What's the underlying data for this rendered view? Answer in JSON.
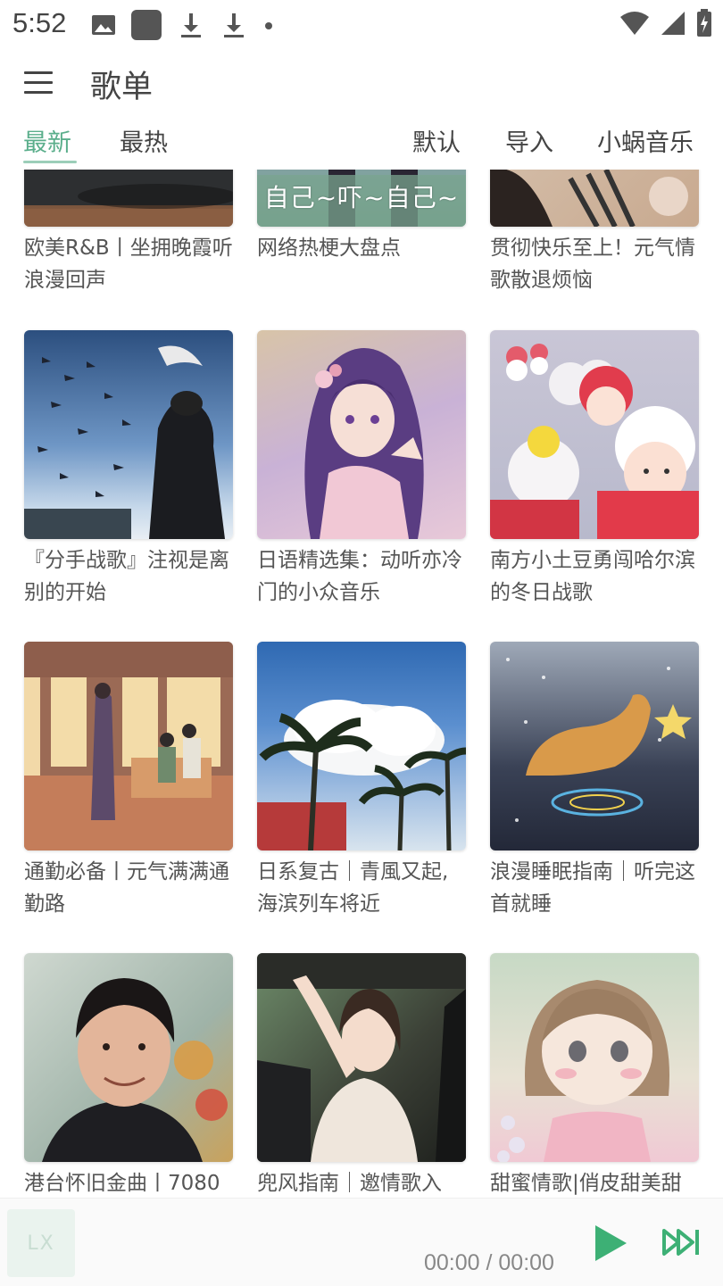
{
  "status_bar": {
    "time": "5:52",
    "icons_left": [
      "image-icon",
      "square-app-icon",
      "download-icon",
      "download-icon",
      "dot-icon"
    ],
    "icons_right": [
      "wifi-icon",
      "signal-icon",
      "battery-charging-icon"
    ]
  },
  "header": {
    "title": "歌单",
    "menu_icon": "hamburger-menu-icon"
  },
  "tabs": {
    "left": [
      {
        "label": "最新",
        "active": true
      },
      {
        "label": "最热",
        "active": false
      }
    ],
    "right": [
      {
        "label": "默认"
      },
      {
        "label": "导入"
      },
      {
        "label": "小蜗音乐"
      }
    ],
    "accent_color": "#5aae8b"
  },
  "playlists": [
    {
      "title": "欧美R&B丨坐拥晚霞听浪漫回声"
    },
    {
      "title": "网络热梗大盘点",
      "cover_text": "自己~吓~自己~"
    },
    {
      "title": "贯彻快乐至上！元气情歌散退烦恼"
    },
    {
      "title": "『分手战歌』注视是离别的开始"
    },
    {
      "title": "日语精选集：动听亦冷门的小众音乐"
    },
    {
      "title": "南方小土豆勇闯哈尔滨的冬日战歌"
    },
    {
      "title": "通勤必备丨元气满满通勤路"
    },
    {
      "title": "日系复古｜青風又起,海滨列车将近"
    },
    {
      "title": "浪漫睡眠指南｜听完这首就睡"
    },
    {
      "title": "港台怀旧金曲丨7080"
    },
    {
      "title": "兜风指南｜邀情歌入"
    },
    {
      "title": "甜蜜情歌|俏皮甜美甜"
    }
  ],
  "player": {
    "logo_text": "LX",
    "time": "00:00 / 00:00",
    "play_icon": "play-icon",
    "next_icon": "skip-next-icon",
    "accent_color": "#3db075"
  }
}
